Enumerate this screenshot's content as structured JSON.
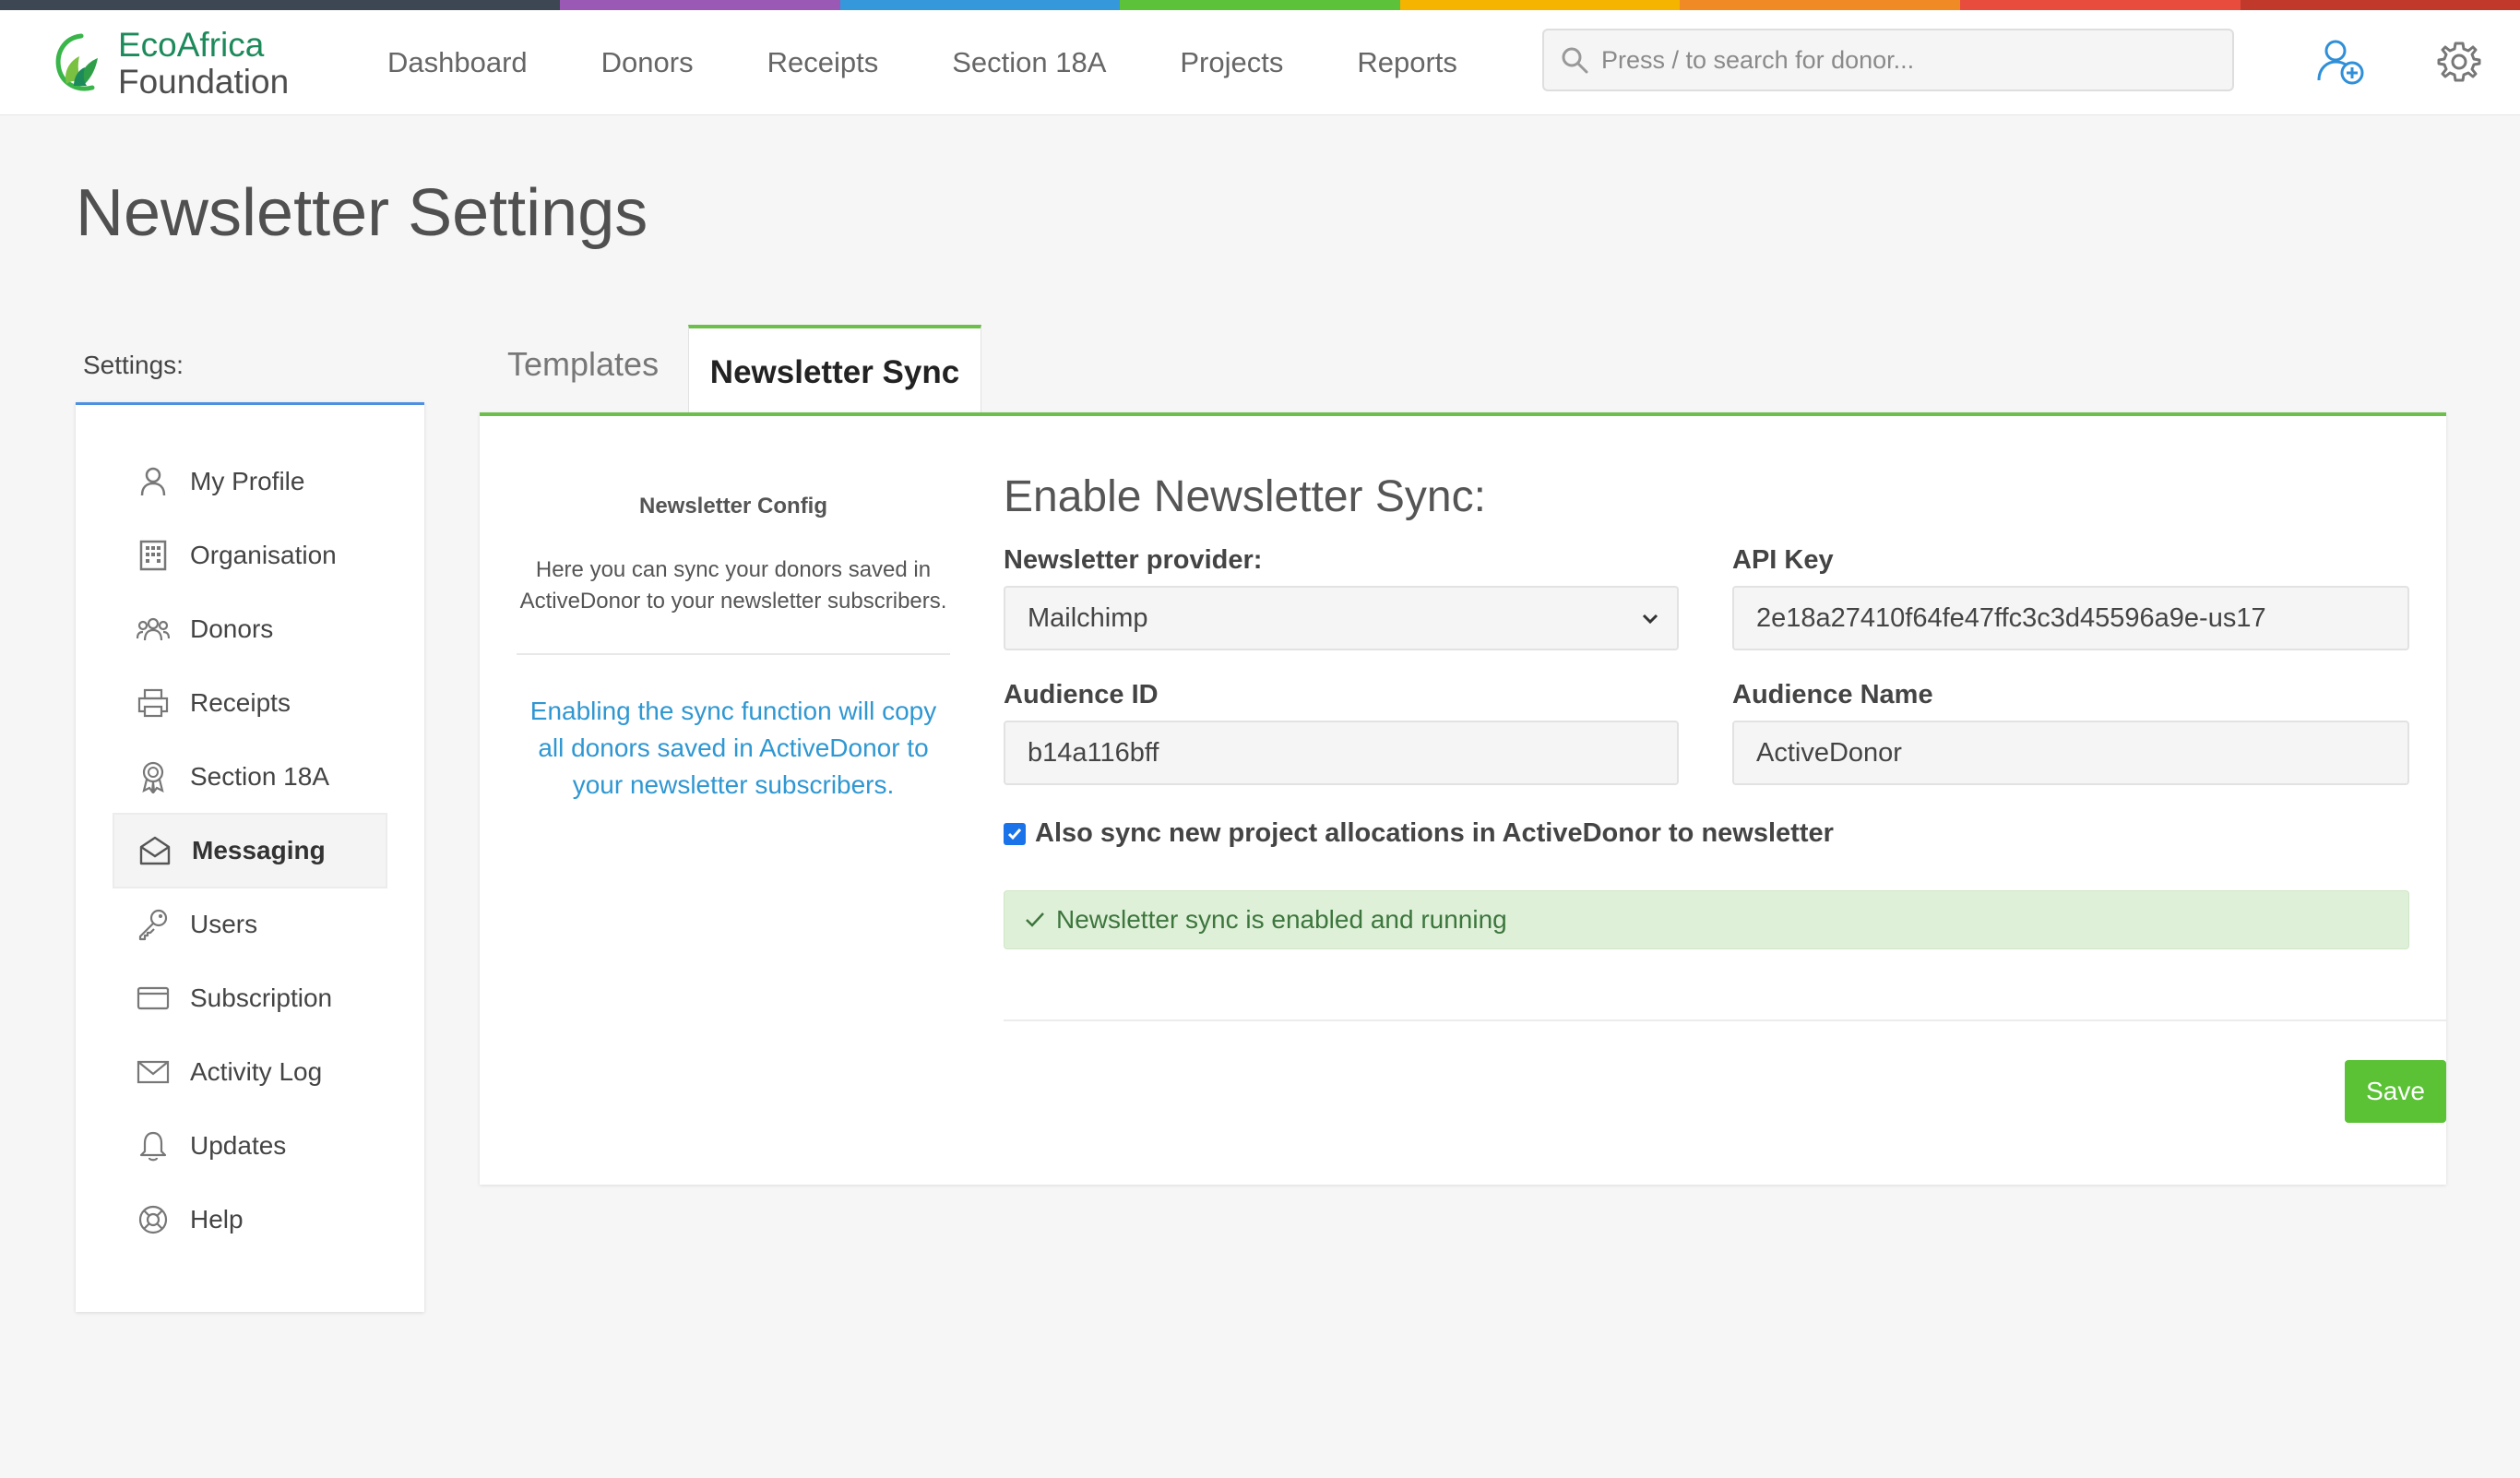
{
  "colors": {
    "rainbow": [
      "#3d4653",
      "#3d4653",
      "#9b59b6",
      "#3498db",
      "#5cc23a",
      "#f5b400",
      "#f08a24",
      "#e74c3c",
      "#c0392b"
    ],
    "accent_green": "#6cc04a",
    "link_blue": "#2f97d2",
    "success_bg": "#dff0d8",
    "success_text": "#3c763d",
    "save_button": "#5bc236"
  },
  "brand": {
    "line1": "EcoAfrica",
    "line2": "Foundation",
    "icon": "leaf-logo-icon"
  },
  "nav": {
    "items": [
      "Dashboard",
      "Donors",
      "Receipts",
      "Section 18A",
      "Projects",
      "Reports"
    ]
  },
  "search": {
    "placeholder": "Press / to search for donor...",
    "icon": "search-icon"
  },
  "header_icons": [
    "add-user-icon",
    "gear-icon"
  ],
  "page": {
    "title": "Newsletter Settings"
  },
  "sidebar": {
    "label": "Settings:",
    "active": "Messaging",
    "items": [
      {
        "label": "My Profile",
        "icon": "user-icon"
      },
      {
        "label": "Organisation",
        "icon": "building-icon"
      },
      {
        "label": "Donors",
        "icon": "users-group-icon"
      },
      {
        "label": "Receipts",
        "icon": "printer-icon"
      },
      {
        "label": "Section 18A",
        "icon": "award-icon"
      },
      {
        "label": "Messaging",
        "icon": "envelope-open-icon"
      },
      {
        "label": "Users",
        "icon": "key-icon"
      },
      {
        "label": "Subscription",
        "icon": "credit-card-icon"
      },
      {
        "label": "Activity Log",
        "icon": "envelope-icon"
      },
      {
        "label": "Updates",
        "icon": "bell-icon"
      },
      {
        "label": "Help",
        "icon": "lifebuoy-icon"
      }
    ]
  },
  "tabs": {
    "templates": "Templates",
    "sync": "Newsletter Sync",
    "active": "Newsletter Sync"
  },
  "config": {
    "title": "Newsletter Config",
    "description": "Here you can sync your donors saved in ActiveDonor to your newsletter subscribers.",
    "note": "Enabling the sync function will copy all donors saved in ActiveDonor to your newsletter subscribers."
  },
  "form": {
    "title": "Enable Newsletter Sync:",
    "provider_label": "Newsletter provider:",
    "provider_value": "Mailchimp",
    "api_key_label": "API Key",
    "api_key_value": "2e18a27410f64fe47ffc3c3d45596a9e-us17",
    "audience_id_label": "Audience ID",
    "audience_id_value": "b14a116bff",
    "audience_name_label": "Audience Name",
    "audience_name_value": "ActiveDonor",
    "sync_projects_label": "Also sync new project allocations in ActiveDonor to newsletter",
    "sync_projects_checked": true,
    "status_text": "Newsletter sync is enabled and running",
    "save_label": "Save"
  }
}
